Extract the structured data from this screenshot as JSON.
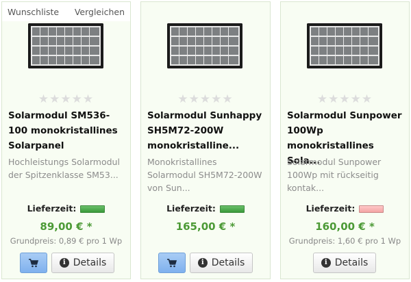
{
  "header": {
    "wishlist_label": "Wunschliste",
    "compare_label": "Vergleichen"
  },
  "colors": {
    "price": "#4c9a36",
    "card_bg": "#f8fdf3",
    "cart_button": "#8db9f0",
    "delivery_ok": "#4aa84a",
    "delivery_bad": "#f5b0b0"
  },
  "products": [
    {
      "title": "Solarmodul SM536-100 monokristallines Solarpanel",
      "description": "Hochleistungs Solarmodul der Spitzenklasse SM53...",
      "rating_stars": 0,
      "delivery_label": "Lieferzeit:",
      "delivery_status": "green",
      "price": "89,00 € *",
      "base_price": "Grundpreis: 0,89 € pro 1 Wp",
      "details_label": "Details",
      "has_cart": true
    },
    {
      "title": "Solarmodul Sunhappy SH5M72-200W monokristalline...",
      "description": "Monokristallines Solarmodul SH5M72-200W von Sun...",
      "rating_stars": 0,
      "delivery_label": "Lieferzeit:",
      "delivery_status": "green",
      "price": "165,00 € *",
      "base_price": "",
      "details_label": "Details",
      "has_cart": true
    },
    {
      "title": "Solarmodul Sunpower 100Wp monokristallines Sola...",
      "description": "Solarmodul Sunpower 100Wp mit rückseitig kontak...",
      "rating_stars": 0,
      "delivery_label": "Lieferzeit:",
      "delivery_status": "red",
      "price": "160,00 € *",
      "base_price": "Grundpreis: 1,60 € pro 1 Wp",
      "details_label": "Details",
      "has_cart": false
    }
  ]
}
